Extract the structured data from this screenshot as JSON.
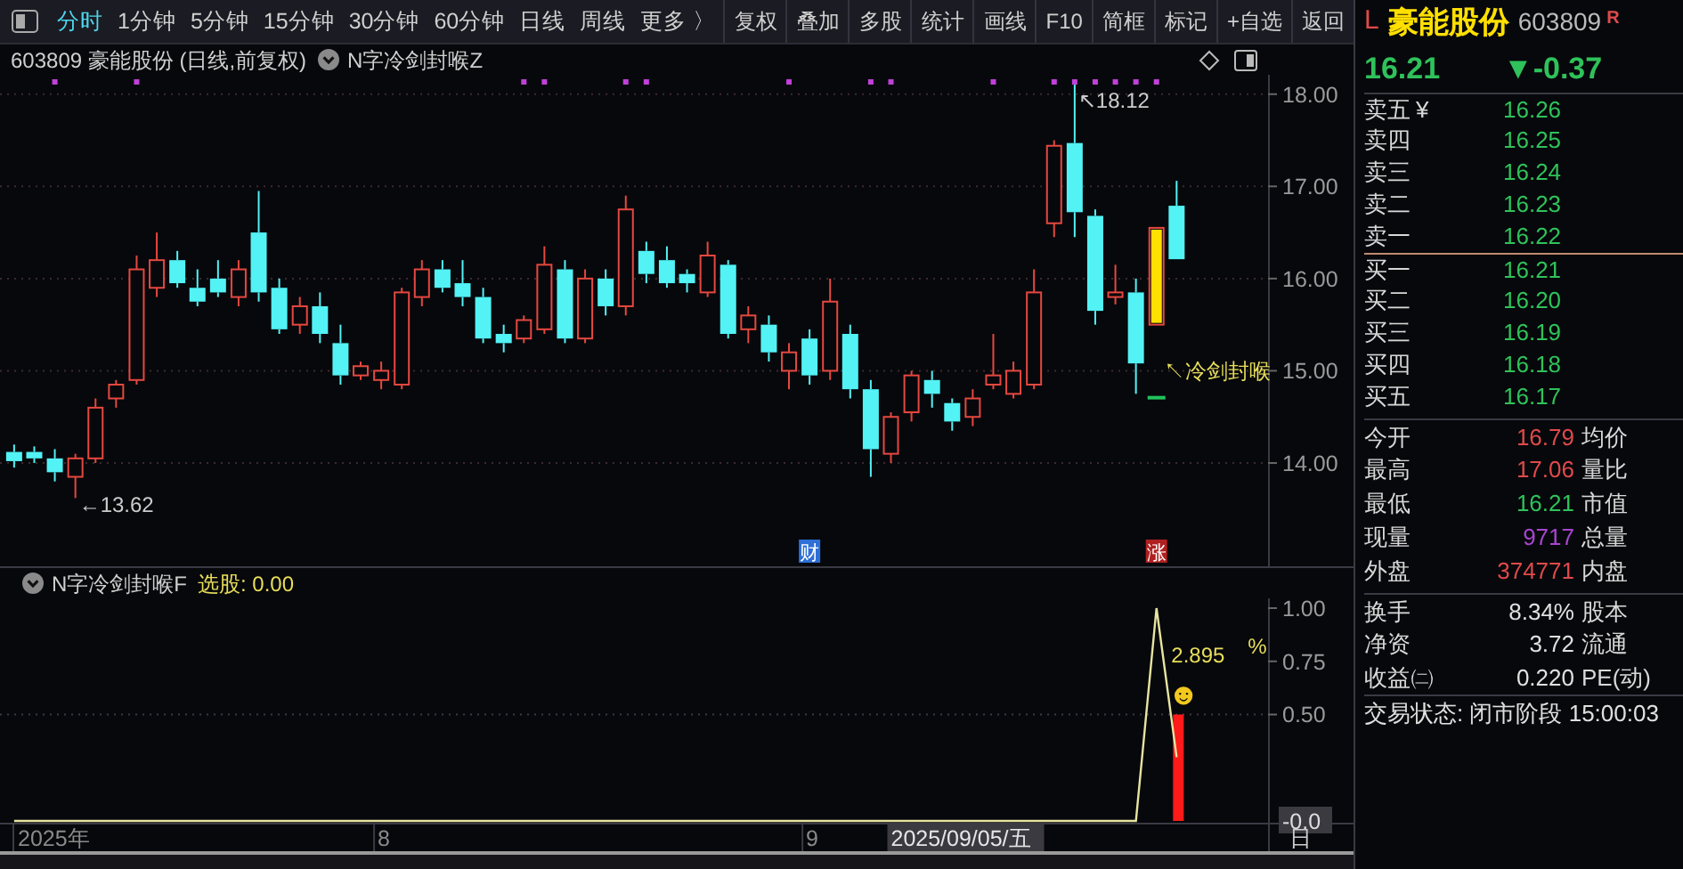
{
  "toolbar": {
    "tabs": [
      {
        "label": "分时",
        "selected": true
      },
      {
        "label": "1分钟",
        "selected": false
      },
      {
        "label": "5分钟",
        "selected": false
      },
      {
        "label": "15分钟",
        "selected": false
      },
      {
        "label": "30分钟",
        "selected": false
      },
      {
        "label": "60分钟",
        "selected": false
      },
      {
        "label": "日线",
        "selected": false
      },
      {
        "label": "周线",
        "selected": false
      },
      {
        "label": "更多 〉",
        "selected": false
      }
    ],
    "buttons": [
      "复权",
      "叠加",
      "多股",
      "统计",
      "画线",
      "F10",
      "简框",
      "标记",
      "+自选",
      "返回"
    ]
  },
  "price_panel": {
    "title": "603809 豪能股份 (日线,前复权)",
    "indicator": "N字冷剑封喉Z",
    "chart_data": {
      "type": "candlestick",
      "grid": true,
      "xlim": [
        7.11,
        10.27
      ],
      "ylim": [
        12.88,
        18.21
      ],
      "yticks": [
        {
          "value": 14,
          "label": "14.00"
        },
        {
          "value": 15,
          "label": "15.00"
        },
        {
          "value": 16,
          "label": "16.00"
        },
        {
          "value": 17,
          "label": "17.00"
        },
        {
          "value": 18,
          "label": "18.00"
        }
      ],
      "x": [
        7.143,
        7.19,
        7.238,
        7.286,
        7.333,
        7.381,
        7.429,
        7.476,
        7.524,
        7.571,
        7.619,
        7.667,
        7.714,
        7.762,
        7.81,
        7.857,
        7.905,
        7.952,
        8.0,
        8.048,
        8.095,
        8.143,
        8.19,
        8.238,
        8.286,
        8.333,
        8.381,
        8.429,
        8.476,
        8.524,
        8.571,
        8.619,
        8.667,
        8.714,
        8.762,
        8.81,
        8.857,
        8.905,
        8.952,
        9.0,
        9.048,
        9.095,
        9.143,
        9.19,
        9.238,
        9.286,
        9.333,
        9.381,
        9.429,
        9.476,
        9.524,
        9.571,
        9.619,
        9.667,
        9.714,
        9.762,
        9.81,
        9.857
      ],
      "ohlc": [
        [
          14.12,
          14.2,
          13.95,
          14.02
        ],
        [
          14.12,
          14.18,
          14.0,
          14.05
        ],
        [
          14.05,
          14.15,
          13.8,
          13.9
        ],
        [
          13.85,
          14.1,
          13.62,
          14.05
        ],
        [
          14.05,
          14.7,
          14.0,
          14.6
        ],
        [
          14.7,
          14.9,
          14.6,
          14.85
        ],
        [
          14.9,
          16.25,
          14.85,
          16.1
        ],
        [
          15.9,
          16.5,
          15.8,
          16.2
        ],
        [
          16.2,
          16.3,
          15.9,
          15.95
        ],
        [
          15.9,
          16.1,
          15.7,
          15.75
        ],
        [
          16.0,
          16.2,
          15.8,
          15.85
        ],
        [
          15.8,
          16.2,
          15.7,
          16.1
        ],
        [
          16.5,
          16.95,
          15.75,
          15.85
        ],
        [
          15.9,
          16.0,
          15.4,
          15.45
        ],
        [
          15.5,
          15.8,
          15.4,
          15.7
        ],
        [
          15.7,
          15.85,
          15.3,
          15.4
        ],
        [
          15.3,
          15.5,
          14.85,
          14.95
        ],
        [
          14.95,
          15.1,
          14.9,
          15.05
        ],
        [
          14.9,
          15.1,
          14.8,
          15.0
        ],
        [
          14.85,
          15.9,
          14.8,
          15.85
        ],
        [
          15.8,
          16.2,
          15.7,
          16.1
        ],
        [
          16.1,
          16.2,
          15.85,
          15.9
        ],
        [
          15.95,
          16.2,
          15.7,
          15.8
        ],
        [
          15.8,
          15.9,
          15.3,
          15.35
        ],
        [
          15.4,
          15.5,
          15.2,
          15.3
        ],
        [
          15.35,
          15.6,
          15.3,
          15.55
        ],
        [
          15.45,
          16.35,
          15.4,
          16.15
        ],
        [
          16.1,
          16.2,
          15.3,
          15.35
        ],
        [
          15.35,
          16.1,
          15.3,
          16.0
        ],
        [
          16.0,
          16.1,
          15.6,
          15.7
        ],
        [
          15.7,
          16.9,
          15.6,
          16.75
        ],
        [
          16.3,
          16.4,
          15.95,
          16.05
        ],
        [
          16.2,
          16.35,
          15.9,
          15.95
        ],
        [
          16.05,
          16.1,
          15.85,
          15.95
        ],
        [
          15.85,
          16.4,
          15.8,
          16.25
        ],
        [
          16.15,
          16.2,
          15.35,
          15.4
        ],
        [
          15.45,
          15.7,
          15.3,
          15.6
        ],
        [
          15.5,
          15.6,
          15.1,
          15.2
        ],
        [
          15.0,
          15.3,
          14.8,
          15.2
        ],
        [
          15.35,
          15.45,
          14.85,
          14.95
        ],
        [
          15.0,
          16.0,
          14.9,
          15.75
        ],
        [
          15.4,
          15.5,
          14.7,
          14.8
        ],
        [
          14.8,
          14.9,
          13.85,
          14.15
        ],
        [
          14.1,
          14.55,
          14.0,
          14.5
        ],
        [
          14.55,
          15.0,
          14.45,
          14.95
        ],
        [
          14.9,
          15.0,
          14.6,
          14.75
        ],
        [
          14.65,
          14.7,
          14.35,
          14.45
        ],
        [
          14.5,
          14.8,
          14.4,
          14.7
        ],
        [
          14.85,
          15.4,
          14.8,
          14.95
        ],
        [
          14.75,
          15.1,
          14.7,
          15.0
        ],
        [
          14.85,
          16.1,
          14.8,
          15.85
        ],
        [
          16.6,
          17.5,
          16.45,
          17.44
        ],
        [
          17.47,
          18.12,
          16.45,
          16.72
        ],
        [
          16.68,
          16.75,
          15.5,
          15.65
        ],
        [
          15.8,
          16.15,
          15.72,
          15.85
        ],
        [
          15.85,
          16.0,
          14.75,
          15.08
        ],
        [
          15.5,
          16.55,
          15.5,
          16.55
        ],
        [
          16.79,
          17.06,
          16.21,
          16.21
        ]
      ],
      "annotations": [
        "↖18.12",
        "←13.62",
        "↖冷剑封喉"
      ]
    },
    "signal_dots": [
      false,
      false,
      true,
      false,
      false,
      false,
      true,
      false,
      false,
      false,
      false,
      false,
      false,
      false,
      false,
      false,
      false,
      false,
      false,
      false,
      false,
      false,
      false,
      false,
      false,
      true,
      true,
      false,
      false,
      false,
      true,
      true,
      false,
      false,
      false,
      false,
      false,
      false,
      true,
      false,
      false,
      false,
      true,
      true,
      false,
      false,
      false,
      false,
      true,
      false,
      false,
      true,
      true,
      true,
      true,
      true,
      true,
      false
    ],
    "events": [
      {
        "label": "财",
        "color": "#2d6fd6"
      },
      {
        "label": "涨",
        "color": "#b02020"
      }
    ]
  },
  "indicator_panel": {
    "indicator": "N字冷剑封喉F",
    "readout": "选股: 0.00",
    "chart_data": {
      "type": "line",
      "xlim": [
        7.11,
        10.27
      ],
      "ylim": [
        0,
        1.046
      ],
      "yticks": [
        {
          "value": 0,
          "label": "-0.0"
        },
        {
          "value": 0.5,
          "label": "0.50"
        },
        {
          "value": 0.75,
          "label": "0.75"
        },
        {
          "value": 1,
          "label": "1.00"
        }
      ],
      "x": [
        7.143,
        7.19,
        7.238,
        7.286,
        7.333,
        7.381,
        7.429,
        7.476,
        7.524,
        7.571,
        7.619,
        7.667,
        7.714,
        7.762,
        7.81,
        7.857,
        7.905,
        7.952,
        8.0,
        8.048,
        8.095,
        8.143,
        8.19,
        8.238,
        8.286,
        8.333,
        8.381,
        8.429,
        8.476,
        8.524,
        8.571,
        8.619,
        8.667,
        8.714,
        8.762,
        8.81,
        8.857,
        8.905,
        8.952,
        9.0,
        9.048,
        9.095,
        9.143,
        9.19,
        9.238,
        9.286,
        9.333,
        9.381,
        9.429,
        9.476,
        9.524,
        9.571,
        9.619,
        9.667,
        9.714,
        9.762,
        9.81,
        9.857
      ],
      "xticks": [
        {
          "value": 8,
          "label": "8"
        },
        {
          "value": 9,
          "label": "9"
        }
      ],
      "series": [
        {
          "color": "#e8e4a0",
          "values": [
            0,
            0,
            0,
            0,
            0,
            0,
            0,
            0,
            0,
            0,
            0,
            0,
            0,
            0,
            0,
            0,
            0,
            0,
            0,
            0,
            0,
            0,
            0,
            0,
            0,
            0,
            0,
            0,
            0,
            0,
            0,
            0,
            0,
            0,
            0,
            0,
            0,
            0,
            0,
            0,
            0,
            0,
            0,
            0,
            0,
            0,
            0,
            0,
            0,
            0,
            0,
            0,
            0,
            0,
            0,
            0,
            1,
            0.3
          ]
        },
        {
          "type": "bar",
          "color": "#ff1a1a",
          "values": [
            null,
            null,
            null,
            null,
            null,
            null,
            null,
            null,
            null,
            null,
            null,
            null,
            null,
            null,
            null,
            null,
            null,
            null,
            null,
            null,
            null,
            null,
            null,
            null,
            null,
            null,
            null,
            null,
            null,
            null,
            null,
            null,
            null,
            null,
            null,
            null,
            null,
            null,
            null,
            null,
            null,
            null,
            null,
            null,
            null,
            null,
            null,
            null,
            null,
            null,
            null,
            null,
            null,
            null,
            null,
            null,
            null,
            0.5
          ]
        }
      ]
    },
    "value_label": "2.895",
    "unit_label": "%",
    "smiley": "☻",
    "year_label": "2025年",
    "cursor_date": "2025/09/05/五",
    "period_button": "日"
  },
  "quote": {
    "prefix": "L",
    "name": "豪能股份",
    "code": "603809",
    "flag": "R",
    "price": "16.21",
    "change": "▼-0.37"
  },
  "asks": [
    {
      "label": "卖五",
      "extra": "¥",
      "price": "16.26"
    },
    {
      "label": "卖四",
      "price": "16.25"
    },
    {
      "label": "卖三",
      "price": "16.24"
    },
    {
      "label": "卖二",
      "price": "16.23"
    },
    {
      "label": "卖一",
      "price": "16.22"
    }
  ],
  "bids": [
    {
      "label": "买一",
      "price": "16.21"
    },
    {
      "label": "买二",
      "price": "16.20"
    },
    {
      "label": "买三",
      "price": "16.19"
    },
    {
      "label": "买四",
      "price": "16.18"
    },
    {
      "label": "买五",
      "price": "16.17"
    }
  ],
  "stats": [
    {
      "label": "今开",
      "value": "16.79",
      "color": "#e04a4a",
      "label_2": "均价"
    },
    {
      "label": "最高",
      "value": "17.06",
      "color": "#e04a4a",
      "label_2": "量比"
    },
    {
      "label": "最低",
      "value": "16.21",
      "color": "#2fc25a",
      "label_2": "市值"
    },
    {
      "label": "现量",
      "value": "9717",
      "color": "#a845d0",
      "label_2": "总量"
    },
    {
      "label": "外盘",
      "value": "374771",
      "color": "#e04a4a",
      "label_2": "内盘"
    }
  ],
  "fundamentals": [
    {
      "label": "换手",
      "value": "8.34%",
      "label_2": "股本"
    },
    {
      "label": "净资",
      "value": "3.72",
      "label_2": "流通"
    },
    {
      "label": "收益㈡",
      "value": "0.220",
      "label_2": "PE(动)"
    }
  ],
  "status": "交易状态: 闭市阶段 15:00:03"
}
